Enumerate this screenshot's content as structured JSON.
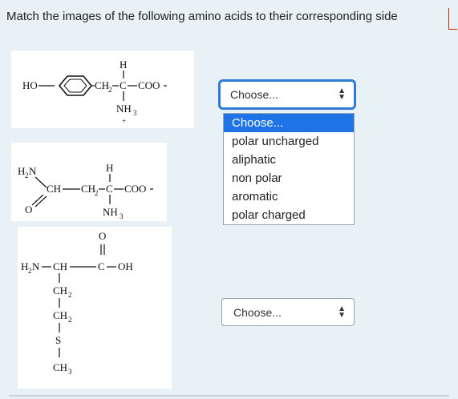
{
  "question": {
    "text": "Match the images of the following amino acids to their corresponding side"
  },
  "selects": [
    {
      "value": "Choose..."
    },
    {
      "value": "Choose..."
    }
  ],
  "dropdown": {
    "options": [
      "Choose...",
      "polar uncharged",
      "aliphatic",
      "non polar",
      "aromatic",
      "polar charged"
    ],
    "selected_index": 0
  },
  "molecules": {
    "tyrosine": {
      "ho": "HO",
      "ch2": "CH",
      "ch2_sub": "2",
      "c": "C",
      "coo": "COO",
      "h": "H",
      "nh": "NH",
      "nh_sub": "3",
      "plus": "+"
    },
    "asparagine": {
      "h2n": "H",
      "h2n_sub": "2",
      "h2n_n": "N",
      "ch": "CH",
      "ch2": "CH",
      "ch2_sub": "2",
      "c": "C",
      "coo": "COO",
      "o": "O",
      "h": "H",
      "nh": "NH",
      "nh_sub": "3"
    },
    "methionine": {
      "o": "O",
      "h2n": "H",
      "h2n_sub": "2",
      "h2n_n": "N",
      "ch": "CH",
      "c": "C",
      "oh": "OH",
      "ch2a": "CH",
      "ch2a_sub": "2",
      "ch2b": "CH",
      "ch2b_sub": "2",
      "s": "S",
      "ch3": "CH",
      "ch3_sub": "3"
    }
  },
  "colors": {
    "accent": "#2f7bd6",
    "selected_bg": "#1e74e6",
    "page_bg": "#e7f1f6"
  }
}
